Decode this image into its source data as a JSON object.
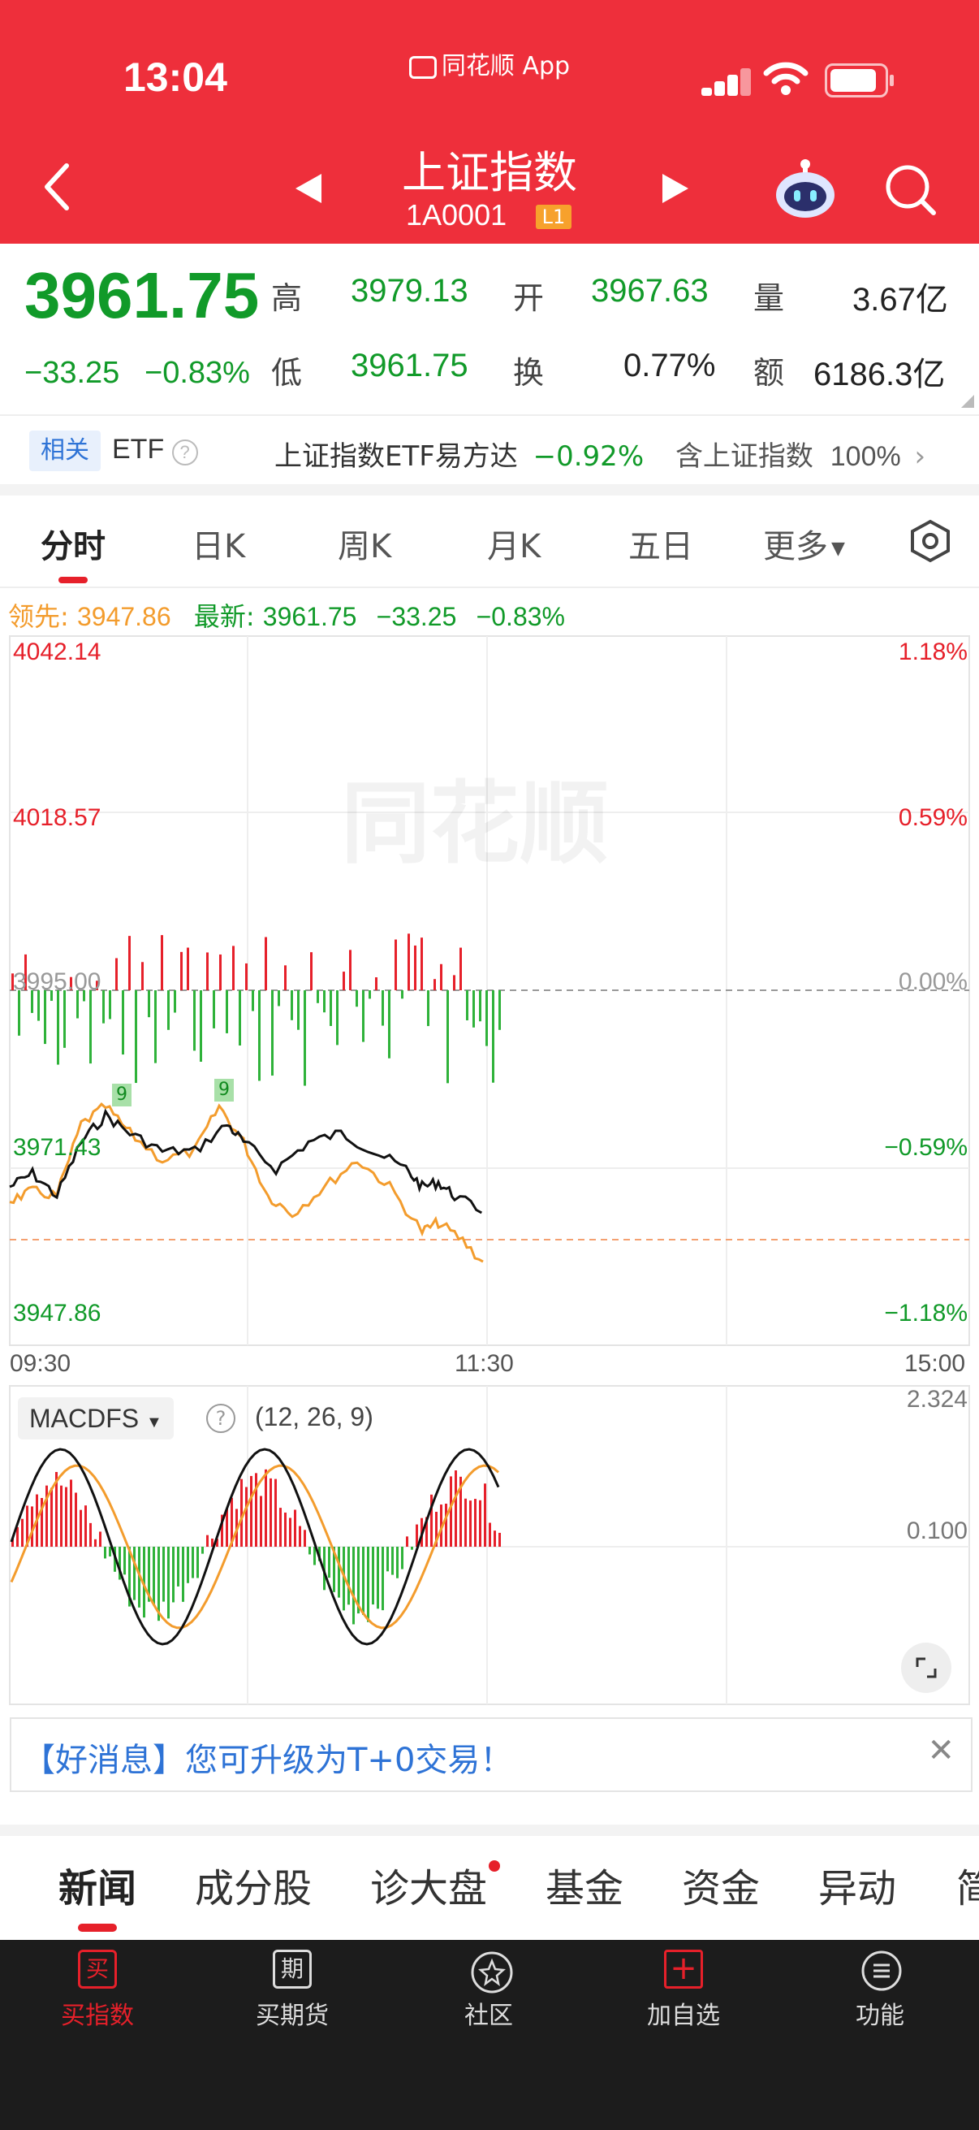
{
  "status_bar": {
    "time": "13:04",
    "app_label": "同花顺 App"
  },
  "header": {
    "title": "上证指数",
    "code": "1A0001",
    "badge": "L1"
  },
  "quote": {
    "price": "3961.75",
    "change": "−33.25",
    "change_pct": "−0.83%",
    "high_label": "高",
    "high": "3979.13",
    "open_label": "开",
    "open": "3967.63",
    "vol_label": "量",
    "vol": "3.67亿",
    "low_label": "低",
    "low": "3961.75",
    "turn_label": "换",
    "turn": "0.77%",
    "amt_label": "额",
    "amt": "6186.3亿"
  },
  "etf_bar": {
    "tag": "相关",
    "etf": "ETF",
    "etf_name": "上证指数ETF易方达",
    "etf_pct": "−0.92%",
    "contain_label": "含上证指数",
    "contain_pct": "100%"
  },
  "tabs": [
    "分时",
    "日K",
    "周K",
    "月K",
    "五日",
    "更多"
  ],
  "legend": {
    "lead_label": "领先: ",
    "lead_val": "3947.86",
    "new_label": "最新: ",
    "new_val": "3961.75",
    "chg": "−33.25",
    "pct": "−0.83%"
  },
  "axis": {
    "p1": "4042.14",
    "p2": "4018.57",
    "p3": "3995.00",
    "p4": "3971.43",
    "p5": "3947.86",
    "r1": "1.18%",
    "r2": "0.59%",
    "r3": "0.00%",
    "r4": "−0.59%",
    "r5": "−1.18%",
    "t1": "09:30",
    "t2": "11:30",
    "t3": "15:00",
    "watermark": "同花顺",
    "tag9": "9"
  },
  "macd": {
    "name": "MACDFS",
    "params": "(12, 26, 9)",
    "top": "2.324",
    "mid": "0.100"
  },
  "banner": {
    "text": "【好消息】您可升级为T+0交易！"
  },
  "bottom_tabs": [
    "新闻",
    "成分股",
    "诊大盘",
    "基金",
    "资金",
    "异动",
    "简"
  ],
  "nav": [
    {
      "label": "买指数",
      "icon": "买"
    },
    {
      "label": "买期货",
      "icon": "期"
    },
    {
      "label": "社区",
      "icon": "community-icon"
    },
    {
      "label": "加自选",
      "icon": "plus-icon"
    },
    {
      "label": "功能",
      "icon": "menu-icon"
    }
  ],
  "colors": {
    "header": "#ee2f3b",
    "up": "#e6202a",
    "down": "#119a29",
    "avg": "#f39c2d"
  },
  "chart_data": {
    "type": "line",
    "x": [
      "09:30",
      "11:30",
      "15:00"
    ],
    "ylim": [
      3947.86,
      4042.14
    ],
    "prev_close": 3995.0,
    "last": 3961.75
  }
}
